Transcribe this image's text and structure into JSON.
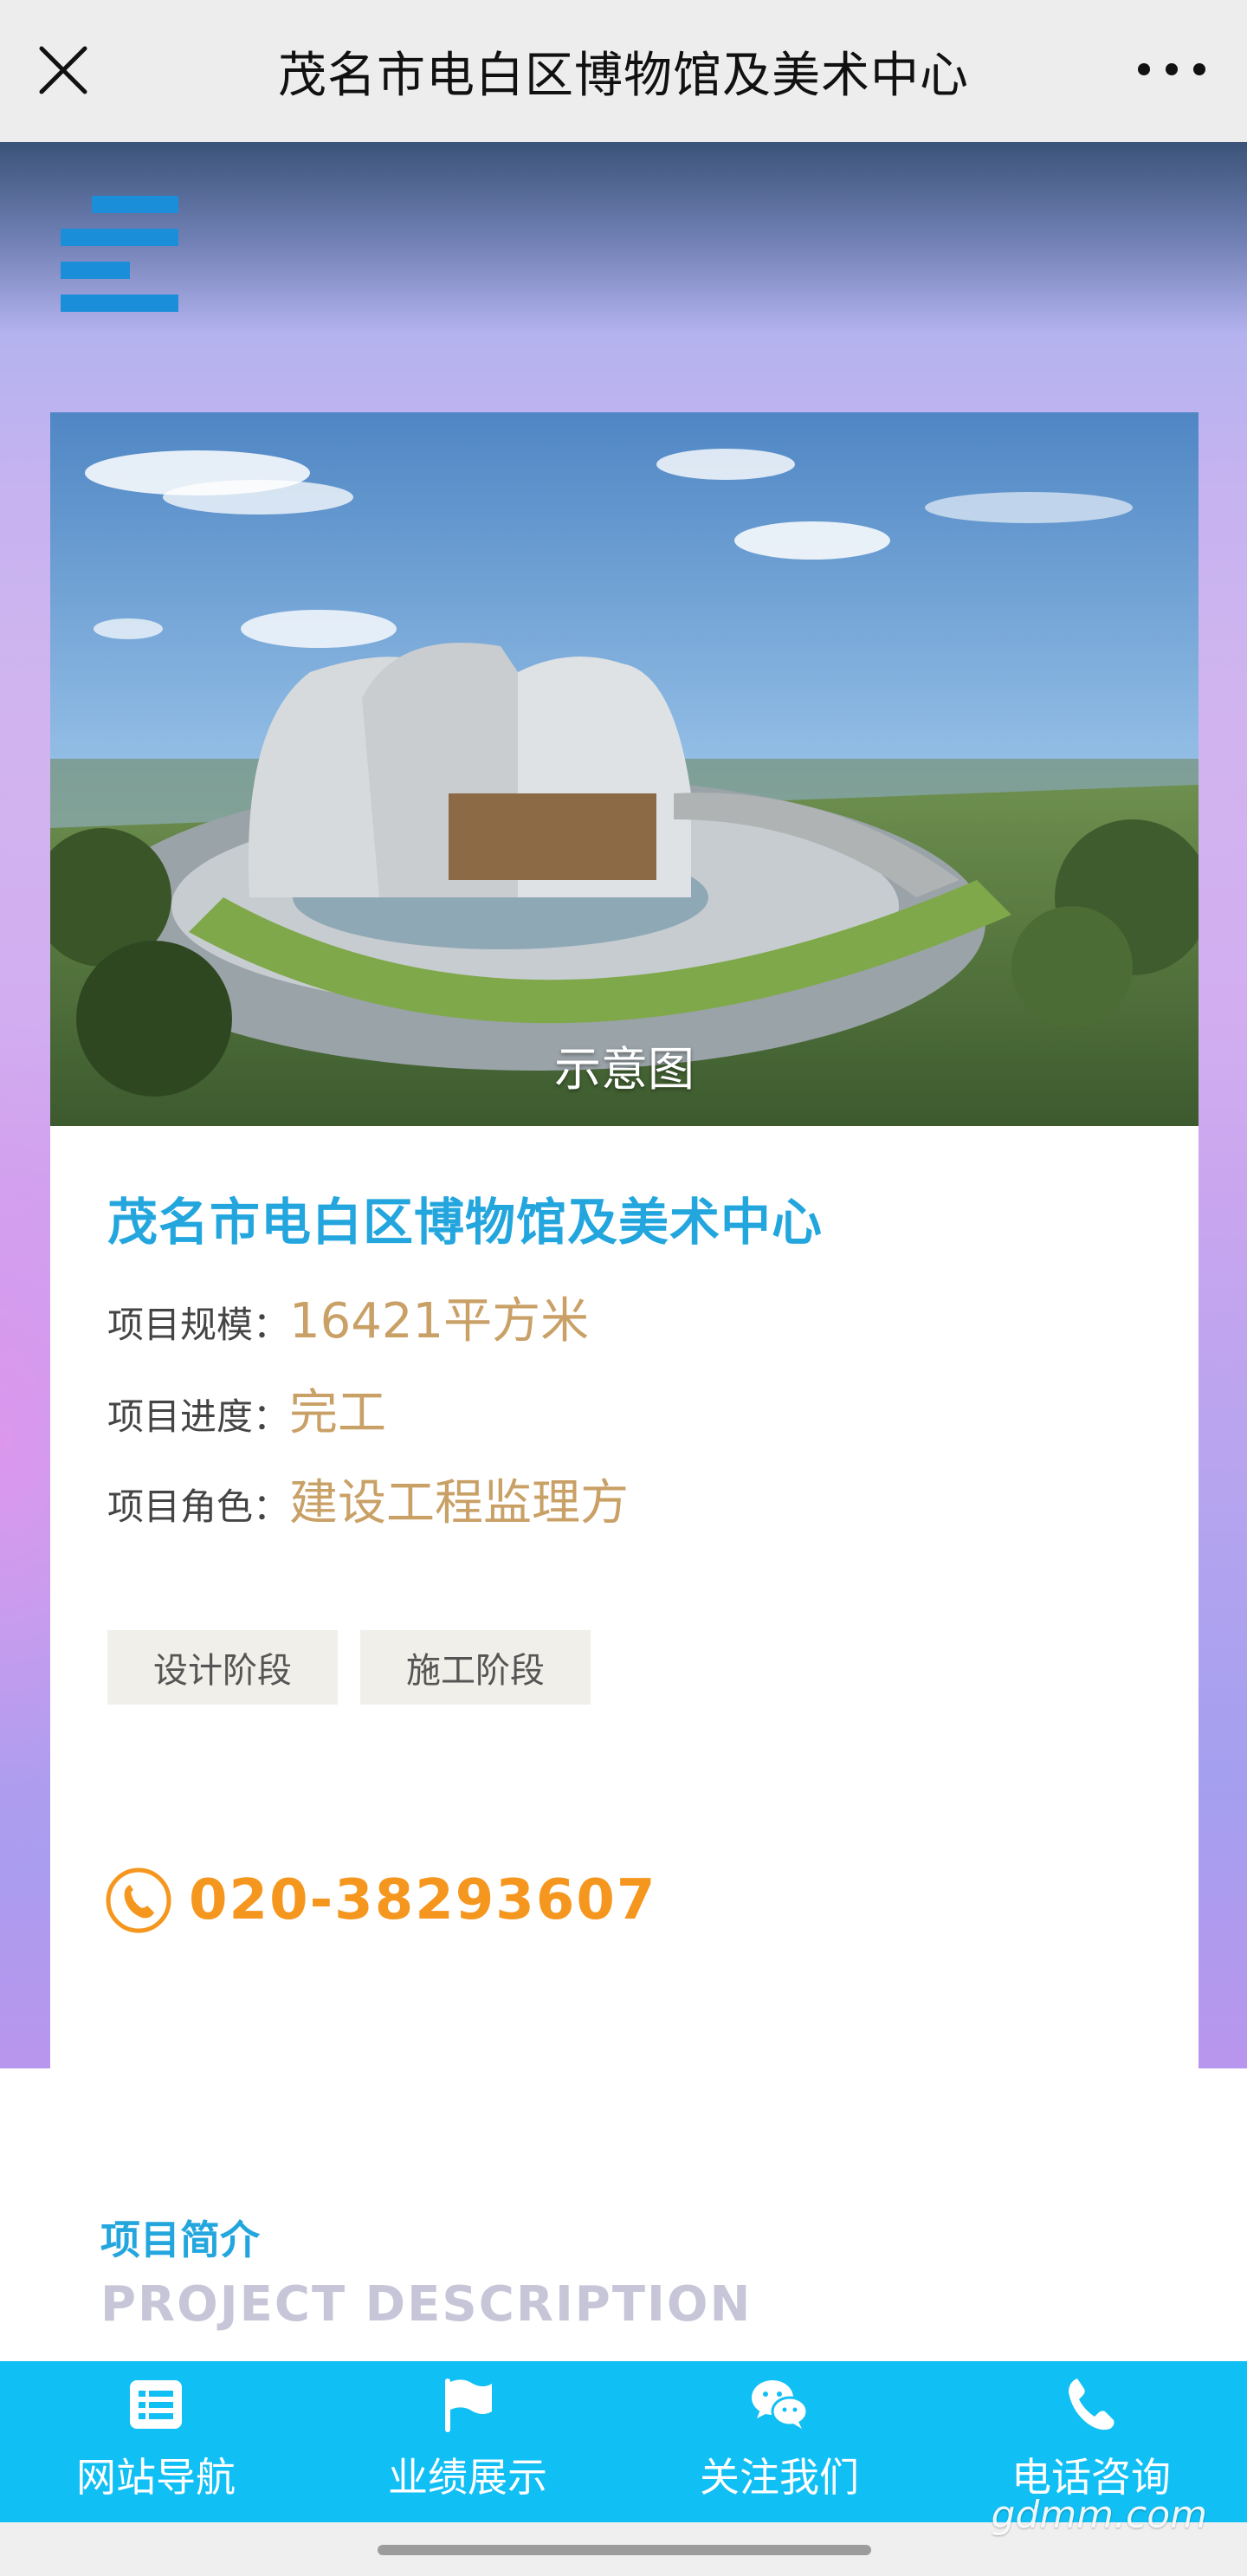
{
  "navbar": {
    "title": "茂名市电白区博物馆及美术中心",
    "close_icon": "close-icon",
    "more_icon": "more-dots-icon"
  },
  "menu": {
    "icon": "menu-icon",
    "color": "#1b8ed9"
  },
  "project": {
    "image_caption": "示意图",
    "title": "茂名市电白区博物馆及美术中心",
    "info": [
      {
        "label": "项目规模：",
        "value": "16421平方米"
      },
      {
        "label": "项目进度：",
        "value": "完工"
      },
      {
        "label": "项目角色：",
        "value": "建设工程监理方"
      }
    ],
    "tags": [
      "设计阶段",
      "施工阶段"
    ],
    "phone": "020-38293607",
    "phone_icon": "phone-circle-icon"
  },
  "description": {
    "title_cn": "项目简介",
    "title_en": "PROJECT DESCRIPTION"
  },
  "tabbar": {
    "items": [
      {
        "label": "网站导航",
        "icon": "list-icon"
      },
      {
        "label": "业绩展示",
        "icon": "flag-icon"
      },
      {
        "label": "关注我们",
        "icon": "wechat-icon"
      },
      {
        "label": "电话咨询",
        "icon": "phone-icon"
      }
    ]
  },
  "watermark": "gdmm.com",
  "colors": {
    "accent_blue": "#23a6de",
    "value_gold": "#c9a066",
    "phone_orange": "#f5961e",
    "tabbar_bg": "#10bff4"
  }
}
